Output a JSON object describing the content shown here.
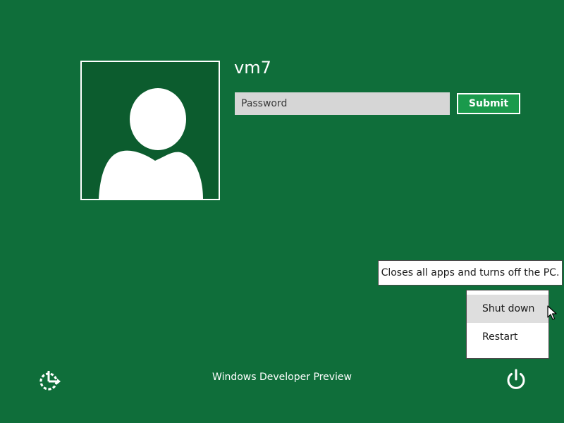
{
  "user": {
    "name": "vm7",
    "avatar_icon": "default-user-silhouette-icon"
  },
  "login": {
    "password_placeholder": "Password",
    "password_value": "",
    "submit_label": "Submit"
  },
  "power_menu": {
    "tooltip": "Closes all apps and turns off the PC.",
    "items": [
      {
        "label": "Shut down",
        "state": "hovered"
      },
      {
        "label": "Restart"
      }
    ]
  },
  "footer": {
    "os_label": "Windows Developer Preview",
    "ease_of_access_icon": "ease-of-access-icon",
    "power_icon": "power-icon"
  },
  "colors": {
    "background": "#0f6e3a",
    "tile_background": "#0c5c2e",
    "submit_background": "#1a9a4c",
    "input_background": "#d6d6d6",
    "menu_hover": "#dedede"
  }
}
